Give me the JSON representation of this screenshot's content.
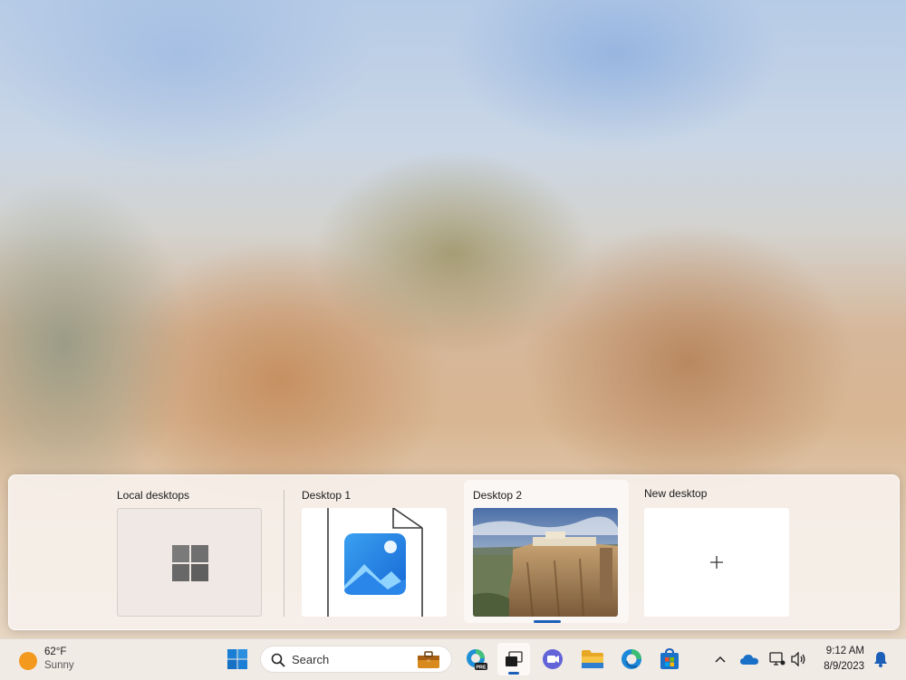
{
  "task_view": {
    "local_desktops_label": "Local desktops",
    "desktops": [
      {
        "label": "Desktop 1"
      },
      {
        "label": "Desktop 2",
        "active": true
      },
      {
        "label": "New desktop"
      }
    ]
  },
  "taskbar": {
    "weather": {
      "temperature": "62°F",
      "condition": "Sunny"
    },
    "search_placeholder": "Search",
    "pinned": [
      "windows-start",
      "search",
      "microsoft-edge-preview",
      "task-view",
      "teams-chat",
      "file-explorer",
      "microsoft-edge",
      "microsoft-store"
    ],
    "tray": {
      "time": "9:12 AM",
      "date": "8/9/2023"
    }
  },
  "colors": {
    "accent": "#1c5fb8",
    "windows_blue": "#0078d4"
  }
}
